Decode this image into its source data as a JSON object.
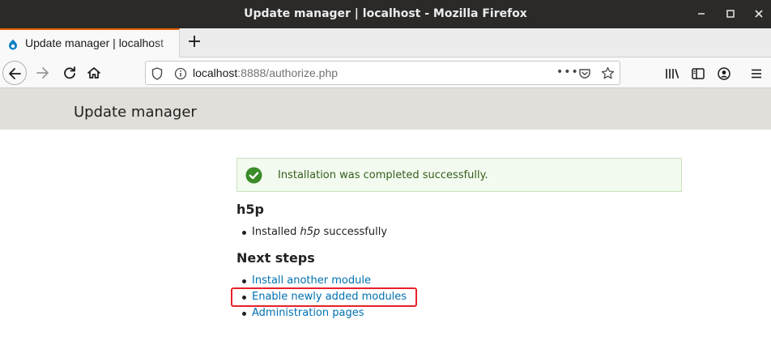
{
  "window": {
    "title": "Update manager | localhost - Mozilla Firefox"
  },
  "tabs": [
    {
      "label": "Update manager | localhost",
      "active": true
    }
  ],
  "navbar": {
    "url_host": "localhost",
    "url_rest": ":8888/authorize.php",
    "more_label": "•••"
  },
  "page": {
    "title": "Update manager",
    "status_message": "Installation was completed successfully.",
    "module_heading": "h5p",
    "installed": {
      "prefix": "Installed",
      "module": "h5p",
      "suffix": "successfully"
    },
    "next_steps_heading": "Next steps",
    "next_steps": [
      {
        "label": "Install another module"
      },
      {
        "label": "Enable newly added modules"
      },
      {
        "label": "Administration pages"
      }
    ]
  },
  "colors": {
    "tab_accent": "#e66000",
    "link": "#0071b3",
    "success_text": "#325e1c",
    "success_icon": "#3a8c28",
    "highlight_box": "#e8202a",
    "header_band": "#e0dfda"
  },
  "icons": [
    "close-icon",
    "minimize-icon",
    "maximize-icon",
    "drupal-favicon",
    "plus-icon",
    "back-arrow-icon",
    "forward-arrow-icon",
    "reload-icon",
    "home-icon",
    "shield-icon",
    "info-icon",
    "pocket-icon",
    "star-icon",
    "library-icon",
    "sidebar-icon",
    "account-icon",
    "hamburger-menu-icon",
    "checkmark-icon"
  ]
}
